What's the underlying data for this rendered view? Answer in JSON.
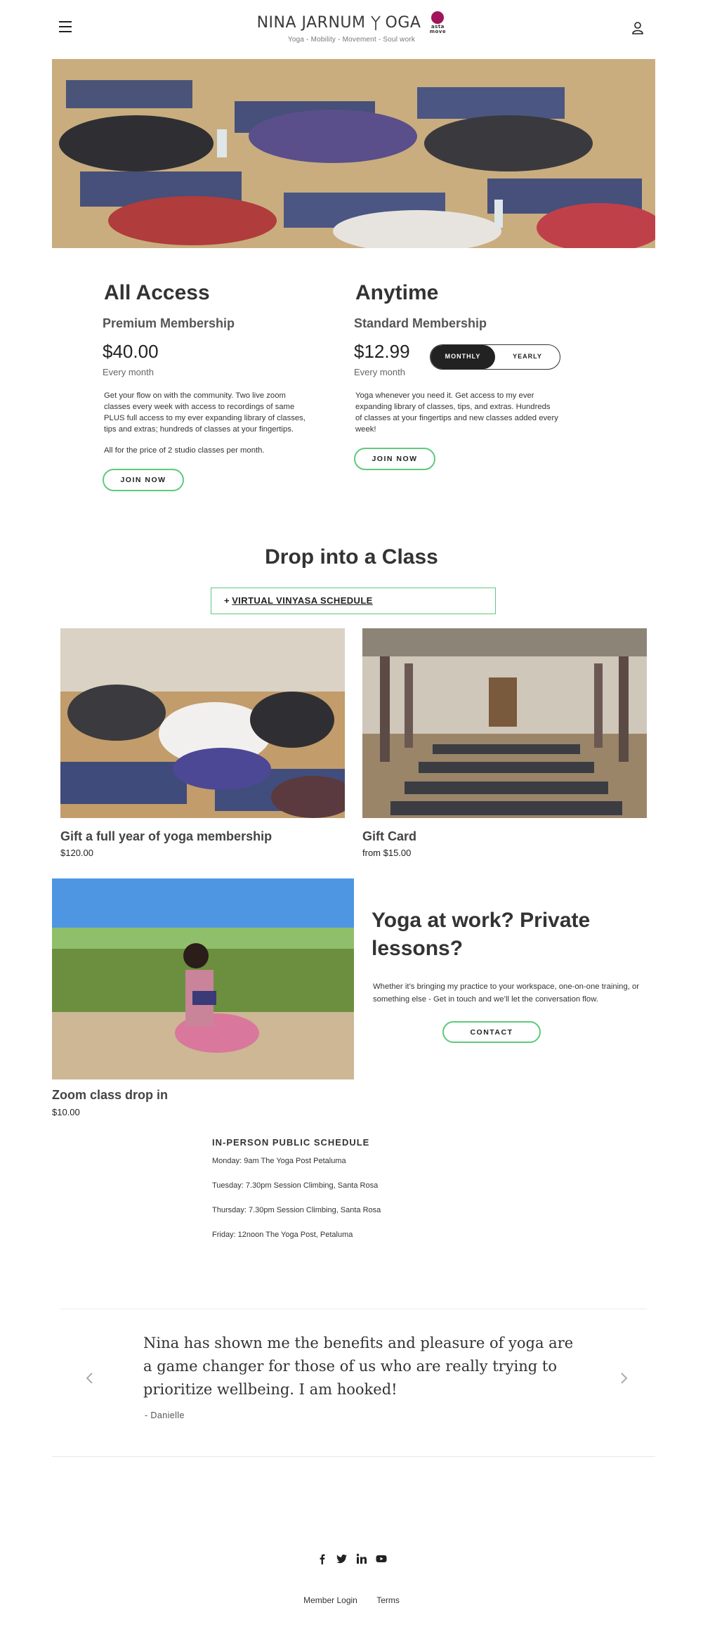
{
  "header": {
    "brand_left": "NINA JARNUM",
    "brand_right": "OGA",
    "brand_mark_text": "asta move",
    "tagline": "Yoga - Mobility - Movement - Soul work"
  },
  "memberships": [
    {
      "title": "All Access",
      "subtitle": "Premium Membership",
      "price": "$40.00",
      "period": "Every month",
      "description": "Get your flow on with the community. Two live zoom classes every week with access to recordings of same PLUS full access to my ever expanding library of classes, tips and extras; hundreds of classes at your fingertips.",
      "description2": "All for the price of 2 studio classes per month.",
      "button": "JOIN NOW"
    },
    {
      "title": "Anytime",
      "subtitle": "Standard Membership",
      "price": "$12.99",
      "period": "Every month",
      "description": "Yoga whenever you need it. Get access to my ever expanding library of classes, tips, and extras. Hundreds of classes at your fingertips and new classes added every week!",
      "button": "JOIN NOW"
    }
  ],
  "billing_toggle": {
    "monthly": "MONTHLY",
    "yearly": "YEARLY",
    "selected": "monthly"
  },
  "drop_in": {
    "title": "Drop into a Class",
    "schedule_prefix": "+",
    "schedule_label": "VIRTUAL VINYASA SCHEDULE"
  },
  "products": [
    {
      "title": "Gift a full year of yoga membership",
      "price": "$120.00"
    },
    {
      "title": "Gift Card",
      "price": "from $15.00"
    },
    {
      "title": "Zoom class drop in",
      "price": "$10.00"
    }
  ],
  "private": {
    "title": "Yoga at work? Private lessons?",
    "description": "Whether it’s bringing my practice to your workspace, one-on-one training, or something else - Get in touch and we’ll let the conversation flow.",
    "button": "CONTACT"
  },
  "in_person": {
    "heading": "IN-PERSON PUBLIC SCHEDULE",
    "items": [
      "Monday: 9am The Yoga Post Petaluma",
      "Tuesday: 7.30pm Session Climbing, Santa Rosa",
      "Thursday: 7.30pm Session Climbing, Santa Rosa",
      "Friday: 12noon The Yoga Post, Petaluma"
    ]
  },
  "testimonial": {
    "quote": "Nina has shown me the benefits and pleasure of yoga are a game changer for those of us who are really trying to prioritize wellbeing. I am hooked!",
    "author": "- Danielle"
  },
  "footer": {
    "social_icons": [
      "facebook-icon",
      "twitter-icon",
      "linkedin-icon",
      "youtube-icon"
    ],
    "links": [
      "Member Login",
      "Terms"
    ]
  },
  "colors": {
    "accent_green": "#5dca7c",
    "brand_magenta": "#a1165a",
    "dark": "#222222"
  }
}
